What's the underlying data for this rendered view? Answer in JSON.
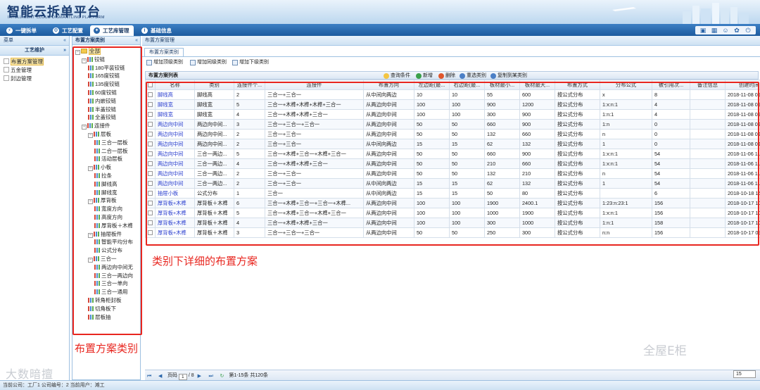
{
  "header": {
    "title": "智能云拆单平台",
    "subtitle": "INTELLIGENT CLOUD DISMANTLING PLATFORM"
  },
  "nav": {
    "tabs": [
      {
        "label": "一键拆单",
        "icon": "lightning-icon"
      },
      {
        "label": "工艺配置",
        "icon": "gear-icon"
      },
      {
        "label": "工艺库管理",
        "icon": "wrench-icon"
      },
      {
        "label": "基础信息",
        "icon": "info-icon"
      }
    ],
    "tools": [
      "monitor-icon",
      "calendar-icon",
      "user-icon",
      "settings-icon",
      "logout-icon"
    ]
  },
  "leftnav": {
    "menu_label": "菜单",
    "section": "工艺维护",
    "items": [
      "布置方案管理",
      "五金管理",
      "封边管理"
    ]
  },
  "catpanel": {
    "title": "布置方案类别"
  },
  "main": {
    "breadcrumb": "布置方案管理",
    "subtab": "布置方案类别",
    "toolbar": [
      "增加顶级类别",
      "增加同级类别",
      "增加下级类别"
    ],
    "grid_title": "布置方案列表",
    "grid_actions": [
      "查询条件",
      "新增",
      "删除",
      "重选类别",
      "复制到某类别"
    ]
  },
  "tree": [
    {
      "l": "全部",
      "d": 0,
      "k": "root"
    },
    {
      "l": "铰链",
      "d": 1,
      "k": "fold"
    },
    {
      "l": "180平装铰链",
      "d": 2,
      "k": "leaf"
    },
    {
      "l": "165度铰链",
      "d": 2,
      "k": "leaf"
    },
    {
      "l": "135度铰链",
      "d": 2,
      "k": "leaf"
    },
    {
      "l": "60度铰链",
      "d": 2,
      "k": "leaf"
    },
    {
      "l": "内嵌铰链",
      "d": 2,
      "k": "leaf"
    },
    {
      "l": "半盖铰链",
      "d": 2,
      "k": "leaf"
    },
    {
      "l": "全盖铰链",
      "d": 2,
      "k": "leaf"
    },
    {
      "l": "连接件",
      "d": 1,
      "k": "fold"
    },
    {
      "l": "层板",
      "d": 2,
      "k": "fold"
    },
    {
      "l": "三合一层板",
      "d": 3,
      "k": "leaf"
    },
    {
      "l": "二合一层板",
      "d": 3,
      "k": "leaf"
    },
    {
      "l": "活动层板",
      "d": 3,
      "k": "leaf"
    },
    {
      "l": "小板",
      "d": 2,
      "k": "fold"
    },
    {
      "l": "拉条",
      "d": 3,
      "k": "leaf"
    },
    {
      "l": "脚线高",
      "d": 3,
      "k": "leaf"
    },
    {
      "l": "脚线宽",
      "d": 3,
      "k": "leaf"
    },
    {
      "l": "厚背板",
      "d": 2,
      "k": "fold"
    },
    {
      "l": "宽度方向",
      "d": 3,
      "k": "leaf"
    },
    {
      "l": "高度方向",
      "d": 3,
      "k": "leaf"
    },
    {
      "l": "厚背板＋木榫",
      "d": 3,
      "k": "leaf"
    },
    {
      "l": "抽屉板件",
      "d": 2,
      "k": "fold"
    },
    {
      "l": "智能平均分布",
      "d": 3,
      "k": "leaf"
    },
    {
      "l": "公式分布",
      "d": 3,
      "k": "leaf"
    },
    {
      "l": "三合一",
      "d": 2,
      "k": "fold"
    },
    {
      "l": "两边向中间无",
      "d": 3,
      "k": "leaf"
    },
    {
      "l": "三合一两边向",
      "d": 3,
      "k": "leaf"
    },
    {
      "l": "三合一单向",
      "d": 3,
      "k": "leaf"
    },
    {
      "l": "三合一通用",
      "d": 3,
      "k": "leaf"
    },
    {
      "l": "转角柜封板",
      "d": 2,
      "k": "leaf"
    },
    {
      "l": "切角板下",
      "d": 2,
      "k": "leaf"
    },
    {
      "l": "层板抽",
      "d": 2,
      "k": "leaf"
    }
  ],
  "columns": [
    "",
    "名称",
    "类别",
    "连接件个...",
    "连接件",
    "布置方向",
    "左边距(最...",
    "右边距(最...",
    "板材最小...",
    "板材最大...",
    "布置方式",
    "分布公式",
    "被引用次...",
    "备注信息",
    "创建时间"
  ],
  "rows": [
    [
      "脚线高",
      "脚线高",
      "2",
      "三合一+三合一",
      "从中间向两边",
      "10",
      "10",
      "55",
      "600",
      "按公式分布",
      "x",
      "8",
      "",
      "2018-11-08 09"
    ],
    [
      "脚线宽",
      "脚线宽",
      "5",
      "三合一+木榫+木榫+木榫+三合一",
      "从两边向中间",
      "100",
      "100",
      "900",
      "1200",
      "按公式分布",
      "1:x:n:1",
      "4",
      "",
      "2018-11-08 09"
    ],
    [
      "脚线宽",
      "脚线宽",
      "4",
      "三合一+木榫+木榫+三合一",
      "从两边向中间",
      "100",
      "100",
      "300",
      "900",
      "按公式分布",
      "1:n:1",
      "4",
      "",
      "2018-11-08 09"
    ],
    [
      "两边向中间",
      "两边向中间...",
      "3",
      "三合一+三合一+三合一",
      "从两边向中间",
      "50",
      "50",
      "660",
      "900",
      "按公式分布",
      "1:n",
      "0",
      "",
      "2018-11-08 09"
    ],
    [
      "两边向中间",
      "两边向中间...",
      "2",
      "三合一+三合一",
      "从两边向中间",
      "50",
      "50",
      "132",
      "660",
      "按公式分布",
      "n",
      "0",
      "",
      "2018-11-08 09"
    ],
    [
      "两边向中间",
      "两边向中间...",
      "2",
      "三合一+三合一",
      "从中间向两边",
      "15",
      "15",
      "62",
      "132",
      "按公式分布",
      "1",
      "0",
      "",
      "2018-11-08 09"
    ],
    [
      "两边向中间",
      "三合一两边...",
      "5",
      "三合一+木榫+三合一+木榫+三合一",
      "从两边向中间",
      "50",
      "50",
      "660",
      "900",
      "按公式分布",
      "1:x:n:1",
      "54",
      "",
      "2018-11-06 11"
    ],
    [
      "两边向中间",
      "三合一两边...",
      "4",
      "三合一+木榫+木榫+三合一",
      "从两边向中间",
      "50",
      "50",
      "210",
      "660",
      "按公式分布",
      "1:x:n:1",
      "54",
      "",
      "2018-11-06 11"
    ],
    [
      "两边向中间",
      "三合一两边...",
      "2",
      "三合一+三合一",
      "从两边向中间",
      "50",
      "50",
      "132",
      "210",
      "按公式分布",
      "n",
      "54",
      "",
      "2018-11-06 11"
    ],
    [
      "两边向中间",
      "三合一两边...",
      "2",
      "三合一+三合一",
      "从中间向两边",
      "15",
      "15",
      "62",
      "132",
      "按公式分布",
      "1",
      "54",
      "",
      "2018-11-06 11"
    ],
    [
      "抽屉小板",
      "公式分布",
      "1",
      "三合一",
      "从中间向两边",
      "15",
      "15",
      "50",
      "80",
      "按公式分布",
      "",
      "6",
      "",
      "2018-10-18 15"
    ],
    [
      "厚背板+木榫",
      "厚背板＋木榫",
      "6",
      "三合一+木榫+三合一+三合一+木榫...",
      "从两边向中间",
      "100",
      "100",
      "1900",
      "2400.1",
      "按公式分布",
      "1:23:n:23:1",
      "156",
      "",
      "2018-10-17 10"
    ],
    [
      "厚背板+木榫",
      "厚背板＋木榫",
      "5",
      "三合一+木榫+三合一+木榫+三合一",
      "从两边向中间",
      "100",
      "100",
      "1000",
      "1900",
      "按公式分布",
      "1:x:n:1",
      "156",
      "",
      "2018-10-17 10"
    ],
    [
      "厚背板+木榫",
      "厚背板＋木榫",
      "4",
      "三合一+木榫+木榫+三合一",
      "从两边向中间",
      "100",
      "100",
      "300",
      "1000",
      "按公式分布",
      "1:n:1",
      "158",
      "",
      "2018-10-17 10"
    ],
    [
      "厚背板+木榫",
      "厚背板＋木榫",
      "3",
      "三合一+三合一+三合一",
      "从两边向中间",
      "50",
      "50",
      "250",
      "300",
      "按公式分布",
      "n:n",
      "156",
      "",
      "2018-10-17 09"
    ]
  ],
  "pager": {
    "page_label": "页码",
    "page": "1",
    "total_pages": "/ 8",
    "info": "第1-15条  共120条",
    "page_size": "15"
  },
  "annotations": {
    "left": "布置方案类别",
    "right": "类别下详细的布置方案"
  },
  "watermarks": {
    "left": "大数暗擅",
    "right": "全屋E柜"
  },
  "status": "当前公司：工厂1   公司编号：2    当前用户：滩工"
}
